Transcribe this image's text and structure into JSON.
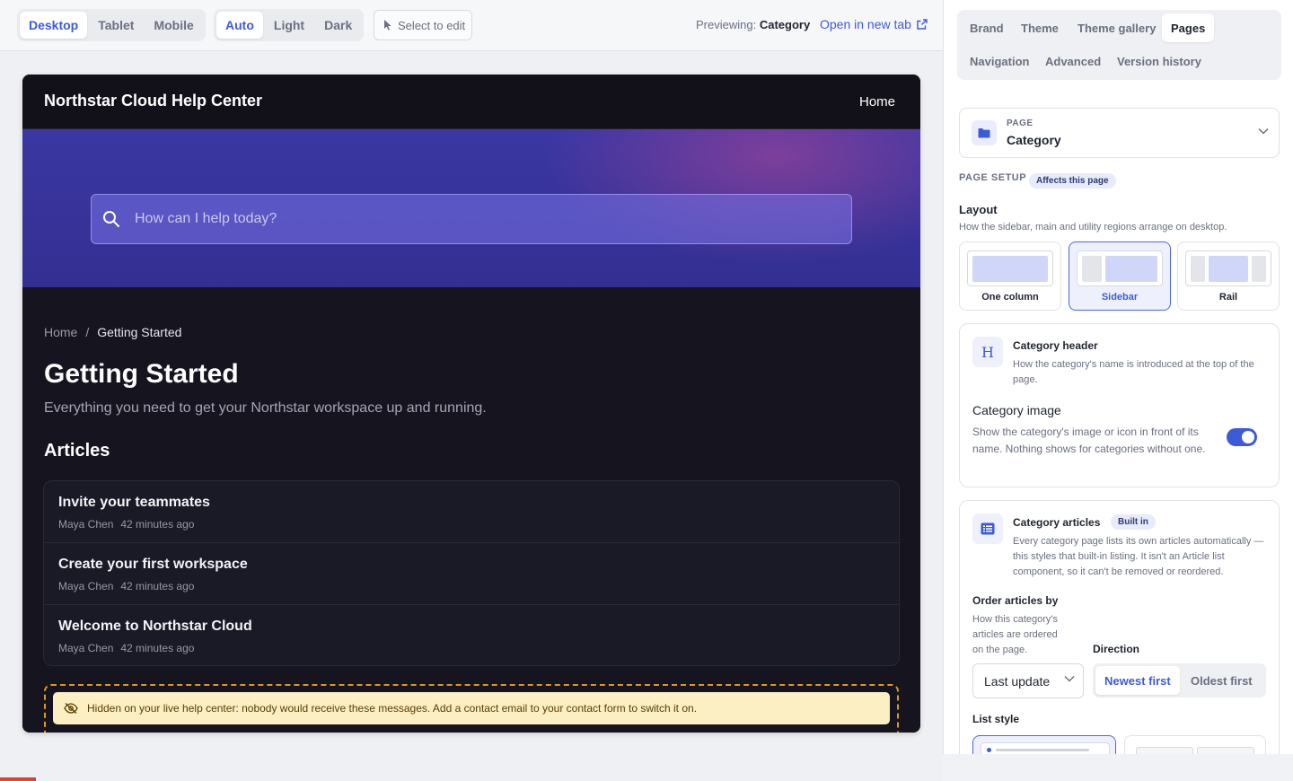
{
  "toolbar": {
    "devices": [
      "Desktop",
      "Tablet",
      "Mobile"
    ],
    "modes": [
      "Auto",
      "Light",
      "Dark"
    ],
    "select_to_edit": "Select to edit",
    "previewing_label": "Previewing:",
    "previewing_value": "Category",
    "open_tab": "Open in new tab"
  },
  "site": {
    "title": "Northstar Cloud Help Center",
    "nav_home": "Home",
    "search_placeholder": "How can I help today?",
    "breadcrumb": [
      "Home",
      "/",
      "Getting Started"
    ],
    "category_title": "Getting Started",
    "category_description": "Everything you need to get your Northstar workspace up and running.",
    "articles_heading": "Articles",
    "articles": [
      {
        "title": "Invite your teammates",
        "author": "Maya Chen",
        "time": "42 minutes ago"
      },
      {
        "title": "Create your first workspace",
        "author": "Maya Chen",
        "time": "42 minutes ago"
      },
      {
        "title": "Welcome to Northstar Cloud",
        "author": "Maya Chen",
        "time": "42 minutes ago"
      }
    ],
    "contact_warning": "Hidden on your live help center: nobody would receive these messages. Add a contact email to your contact form to switch it on."
  },
  "panel": {
    "tabs_row1": [
      "Brand",
      "Theme",
      "Theme gallery",
      "Pages"
    ],
    "tabs_row2": [
      "Navigation",
      "Advanced",
      "Version history"
    ],
    "page_label": "PAGE",
    "page_value": "Category",
    "setup_title": "PAGE SETUP",
    "setup_badge": "Affects this page",
    "layout_title": "Layout",
    "layout_desc": "How the sidebar, main and utility regions arrange on desktop.",
    "layout_options": [
      "One column",
      "Sidebar",
      "Rail"
    ],
    "header_card": {
      "icon_letter": "H",
      "title": "Category header",
      "desc": "How the category's name is introduced at the top of the page.",
      "image_title": "Category image",
      "image_desc": "Show the category's image or icon in front of its name. Nothing shows for categories without one."
    },
    "articles_card": {
      "title": "Category articles",
      "badge": "Built in",
      "desc": "Every category page lists its own articles automatically — this styles that built-in listing. It isn't an Article list component, so it can't be removed or reordered.",
      "order_title": "Order articles by",
      "order_desc": "How this category's articles are ordered on the page.",
      "order_value": "Last update",
      "direction_title": "Direction",
      "directions": [
        "Newest first",
        "Oldest first"
      ],
      "list_style_title": "List style"
    }
  },
  "state": {
    "device": "Desktop",
    "mode": "Auto",
    "panel_tab": "Pages",
    "layout": "Sidebar",
    "category_image_enabled": true,
    "direction": "Newest first"
  },
  "colors": {
    "accent": "#3d5bd9",
    "hero": "#3b37a3",
    "site_bg": "#15141f",
    "warning_bg": "#fcefc4",
    "warning_border": "#d89a22"
  }
}
